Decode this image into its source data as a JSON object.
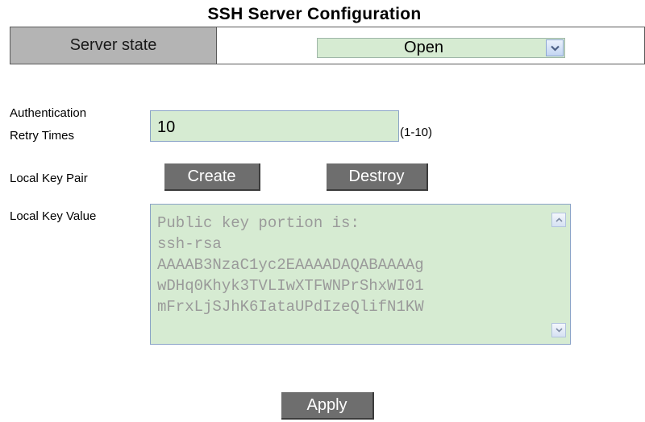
{
  "title": "SSH Server Configuration",
  "server_state": {
    "label": "Server state",
    "value": "Open"
  },
  "auth_retry": {
    "label_line1": "Authentication",
    "label_line2": "Retry Times",
    "value": "10",
    "hint": "(1-10)"
  },
  "local_key_pair": {
    "label": "Local Key Pair",
    "create_label": "Create",
    "destroy_label": "Destroy"
  },
  "local_key_value": {
    "label": "Local Key Value",
    "lines": [
      "Public key portion is:",
      "ssh-rsa",
      "AAAAB3NzaC1yc2EAAAADAQABAAAAg",
      "wDHq0Khyk3TVLIwXTFWNPrShxWI01",
      "mFrxLjSJhK6IataUPdIzeQlifN1KW"
    ]
  },
  "apply_label": "Apply",
  "colors": {
    "field_bg": "#d6ebd2",
    "header_bg": "#b4b4b4",
    "button_bg": "#6e6e6e"
  }
}
